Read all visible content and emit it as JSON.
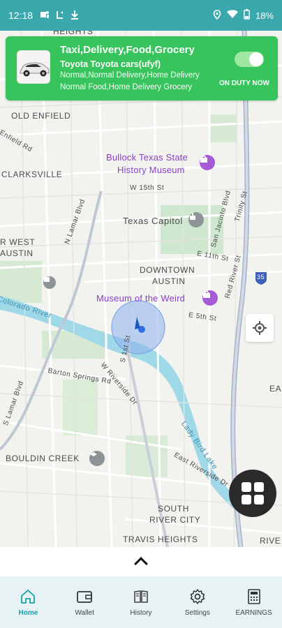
{
  "status_bar": {
    "time": "12:18",
    "battery": "18%",
    "icons": [
      "teams-icon",
      "call-forward-icon",
      "download-icon",
      "location-icon",
      "wifi-icon",
      "battery-icon"
    ]
  },
  "banner": {
    "title": "Taxi,Delivery,Food,Grocery",
    "car": "Toyota Toyota cars(ufyf)",
    "line1": "Normal,Normal Delivery,Home Delivery",
    "line2": "Normal Food,Home Delivery Grocery",
    "duty_label": "ON DUTY NOW",
    "duty_on": true,
    "accent": "#37c45c"
  },
  "map": {
    "labels": {
      "heights": "HEIGHTS",
      "old_enfield": "OLD ENFIELD",
      "enfield_rd": "Enfield Rd",
      "clarksville": "CLARKSVILLE",
      "bullock_1": "Bullock Texas State",
      "bullock_2": "History Museum",
      "w15": "W 15th St",
      "texas_capitol": "Texas Capitol",
      "west_austin_1": "R WEST",
      "west_austin_2": "AUSTIN",
      "n_lamar": "N Lamar Blvd",
      "san_jacinto": "San Jacinto Blvd",
      "trinity": "Trinity St",
      "e11": "E 11th St",
      "downtown_1": "DOWNTOWN",
      "downtown_2": "AUSTIN",
      "red_river": "Red River St",
      "museum_weird": "Museum of the Weird",
      "colorado": "Colorado River",
      "e5": "E 5th St",
      "s1": "S 1st St",
      "w_riverside": "W Riverside Dr",
      "barton": "Barton Springs Rd",
      "s_lamar": "S Lamar Blvd",
      "bouldin": "BOULDIN CREEK",
      "lady_bird": "Lady Bird Lake",
      "e_riverside": "East Riverside Dr",
      "south_river_1": "SOUTH",
      "south_river_2": "RIVER CITY",
      "travis": "TRAVIS HEIGHTS",
      "riv": "RIVE",
      "ea": "EA",
      "i35": "35"
    }
  },
  "nav": {
    "items": [
      {
        "label": "Home",
        "icon": "home-icon"
      },
      {
        "label": "Wallet",
        "icon": "wallet-icon"
      },
      {
        "label": "History",
        "icon": "history-icon"
      },
      {
        "label": "Settings",
        "icon": "settings-icon"
      },
      {
        "label": "EARNINGS",
        "icon": "earnings-icon"
      }
    ],
    "active": "Home",
    "active_color": "#1aa0a8"
  }
}
